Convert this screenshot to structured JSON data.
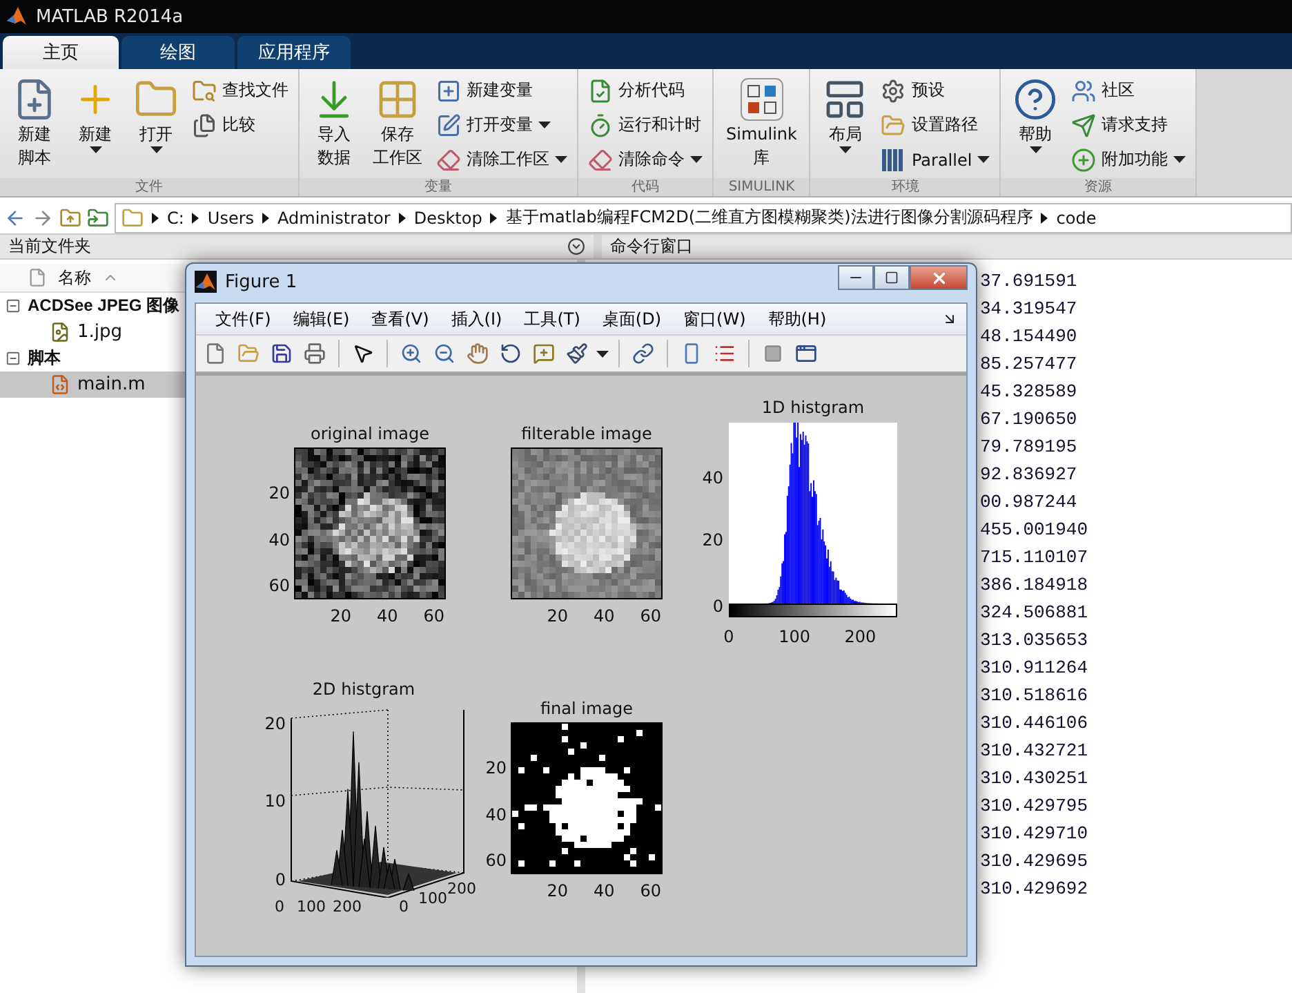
{
  "app_title": "MATLAB R2014a",
  "tabs": [
    {
      "label": "主页",
      "selected": true
    },
    {
      "label": "绘图",
      "selected": false
    },
    {
      "label": "应用程序",
      "selected": false
    }
  ],
  "ribbon": [
    {
      "label": "文件",
      "items": [
        {
          "kind": "large",
          "lines": [
            "新建",
            "脚本"
          ],
          "dropdown": false
        },
        {
          "kind": "large",
          "lines": [
            "新建"
          ],
          "dropdown": true
        },
        {
          "kind": "large",
          "lines": [
            "打开"
          ],
          "dropdown": true
        },
        {
          "kind": "small",
          "lines": [
            "查找文件"
          ],
          "dropdown": false
        },
        {
          "kind": "small",
          "lines": [
            "比较"
          ],
          "dropdown": false
        }
      ]
    },
    {
      "label": "变量",
      "items": [
        {
          "kind": "large",
          "lines": [
            "导入",
            "数据"
          ],
          "dropdown": false
        },
        {
          "kind": "large",
          "lines": [
            "保存",
            "工作区"
          ],
          "dropdown": false
        },
        {
          "kind": "small",
          "lines": [
            "新建变量"
          ],
          "dropdown": false
        },
        {
          "kind": "small",
          "lines": [
            "打开变量"
          ],
          "dropdown": true
        },
        {
          "kind": "small",
          "lines": [
            "清除工作区"
          ],
          "dropdown": true
        }
      ]
    },
    {
      "label": "代码",
      "items": [
        {
          "kind": "small",
          "lines": [
            "分析代码"
          ],
          "dropdown": false
        },
        {
          "kind": "small",
          "lines": [
            "运行和计时"
          ],
          "dropdown": false
        },
        {
          "kind": "small",
          "lines": [
            "清除命令"
          ],
          "dropdown": true
        }
      ]
    },
    {
      "label": "SIMULINK",
      "items": [
        {
          "kind": "large",
          "lines": [
            "Simulink",
            "库"
          ],
          "dropdown": false
        }
      ]
    },
    {
      "label": "环境",
      "items": [
        {
          "kind": "large",
          "lines": [
            "布局"
          ],
          "dropdown": true
        },
        {
          "kind": "small",
          "lines": [
            "预设"
          ],
          "dropdown": false
        },
        {
          "kind": "small",
          "lines": [
            "设置路径"
          ],
          "dropdown": false
        },
        {
          "kind": "small",
          "lines": [
            "Parallel"
          ],
          "dropdown": true
        }
      ]
    },
    {
      "label": "资源",
      "items": [
        {
          "kind": "large",
          "lines": [
            "帮助"
          ],
          "dropdown": true
        },
        {
          "kind": "small",
          "lines": [
            "社区"
          ],
          "dropdown": false
        },
        {
          "kind": "small",
          "lines": [
            "请求支持"
          ],
          "dropdown": false
        },
        {
          "kind": "small",
          "lines": [
            "附加功能"
          ],
          "dropdown": true
        }
      ]
    }
  ],
  "address": {
    "segments": [
      "C:",
      "Users",
      "Administrator",
      "Desktop",
      "基于matlab编程FCM2D(二维直方图模糊聚类)法进行图像分割源码程序",
      "code"
    ]
  },
  "file_browser": {
    "title": "当前文件夹",
    "column": "名称",
    "groups": [
      {
        "label": "ACDSee JPEG 图像",
        "expanded": true,
        "children": [
          {
            "label": "1.jpg",
            "selected": false
          }
        ]
      },
      {
        "label": "脚本",
        "expanded": true,
        "children": [
          {
            "label": "main.m",
            "selected": true
          }
        ]
      }
    ]
  },
  "command_window": {
    "title": "命令行窗口",
    "lines": [
      "37.691591",
      "34.319547",
      "48.154490",
      "85.257477",
      "45.328589",
      "67.190650",
      "79.789195",
      "92.836927",
      "00.987244",
      "455.001940",
      "715.110107",
      "386.184918",
      "324.506881",
      "313.035653",
      "310.911264",
      "310.518616",
      "310.446106",
      "310.432721",
      "310.430251",
      "310.429795",
      "310.429710",
      "310.429695",
      "310.429692"
    ]
  },
  "figure": {
    "title": "Figure 1",
    "menu": [
      "文件(F)",
      "编辑(E)",
      "查看(V)",
      "插入(I)",
      "工具(T)",
      "桌面(D)",
      "窗口(W)",
      "帮助(H)"
    ],
    "plots": [
      {
        "kind": "noisy-image",
        "title": "original image",
        "xticks": [
          "20",
          "40",
          "60"
        ],
        "yticks": [
          "20",
          "40",
          "60"
        ]
      },
      {
        "kind": "smooth-image",
        "title": "filterable image",
        "xticks": [
          "20",
          "40",
          "60"
        ]
      },
      {
        "kind": "histogram",
        "title": "1D histgram",
        "xticks": [
          "0",
          "100",
          "200"
        ],
        "yticks": [
          "40",
          "20",
          "0"
        ]
      },
      {
        "kind": "surface",
        "title": "2D histgram",
        "zticks": [
          "20",
          "10",
          "0"
        ],
        "xticks": [
          "0",
          "100",
          "200"
        ],
        "yticks": [
          "0",
          "100",
          "200"
        ]
      },
      {
        "kind": "binary-image",
        "title": "final image",
        "xticks": [
          "20",
          "40",
          "60"
        ],
        "yticks": [
          "20",
          "40",
          "60"
        ]
      }
    ]
  }
}
